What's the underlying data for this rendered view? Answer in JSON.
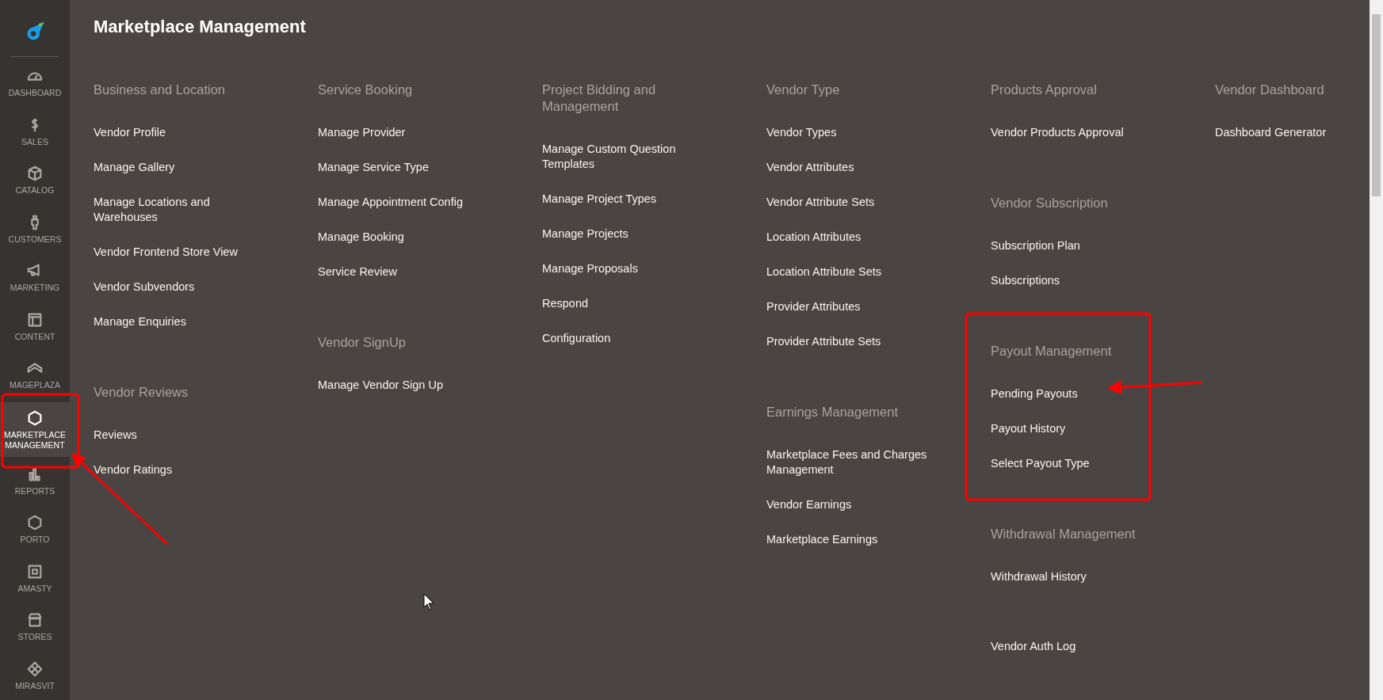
{
  "sidebar": {
    "items": [
      {
        "label": "DASHBOARD",
        "selected": false
      },
      {
        "label": "SALES",
        "selected": false
      },
      {
        "label": "CATALOG",
        "selected": false
      },
      {
        "label": "CUSTOMERS",
        "selected": false
      },
      {
        "label": "MARKETING",
        "selected": false
      },
      {
        "label": "CONTENT",
        "selected": false
      },
      {
        "label": "MAGEPLAZA",
        "selected": false
      },
      {
        "label": "MARKETPLACE MANAGEMENT",
        "selected": true
      },
      {
        "label": "REPORTS",
        "selected": false
      },
      {
        "label": "PORTO",
        "selected": false
      },
      {
        "label": "AMASTY",
        "selected": false
      },
      {
        "label": "STORES",
        "selected": false
      },
      {
        "label": "MIRASVIT",
        "selected": false
      }
    ]
  },
  "page_title": "Marketplace Management",
  "columns": [
    {
      "groups": [
        {
          "title": "Business and Location",
          "items": [
            "Vendor Profile",
            "Manage Gallery",
            "Manage Locations and Warehouses",
            "Vendor Frontend Store View",
            "Vendor Subvendors",
            "Manage Enquiries"
          ]
        },
        {
          "title": "Vendor Reviews",
          "items": [
            "Reviews",
            "Vendor Ratings"
          ]
        }
      ]
    },
    {
      "groups": [
        {
          "title": "Service Booking",
          "items": [
            "Manage Provider",
            "Manage Service Type",
            "Manage Appointment Config",
            "Manage Booking",
            "Service Review"
          ]
        },
        {
          "title": "Vendor SignUp",
          "items": [
            "Manage Vendor Sign Up"
          ]
        }
      ]
    },
    {
      "groups": [
        {
          "title": "Project Bidding and Management",
          "items": [
            "Manage Custom Question Templates",
            "Manage Project Types",
            "Manage Projects",
            "Manage Proposals",
            "Respond",
            "Configuration"
          ]
        }
      ]
    },
    {
      "groups": [
        {
          "title": "Vendor Type",
          "items": [
            "Vendor Types",
            "Vendor Attributes",
            "Vendor Attribute Sets",
            "Location Attributes",
            "Location Attribute Sets",
            "Provider Attributes",
            "Provider Attribute Sets"
          ]
        },
        {
          "title": "Earnings Management",
          "items": [
            "Marketplace Fees and Charges Management",
            "Vendor Earnings",
            "Marketplace Earnings"
          ]
        }
      ]
    },
    {
      "groups": [
        {
          "title": "Products Approval",
          "items": [
            "Vendor Products Approval"
          ]
        },
        {
          "title": "Vendor Subscription",
          "items": [
            "Subscription Plan",
            "Subscriptions"
          ]
        },
        {
          "title": "Payout Management",
          "items": [
            "Pending Payouts",
            "Payout History",
            "Select Payout Type"
          ]
        },
        {
          "title": "Withdrawal Management",
          "items": [
            "Withdrawal History"
          ]
        },
        {
          "items": [
            "Vendor Auth Log"
          ]
        }
      ]
    },
    {
      "groups": [
        {
          "title": "Vendor Dashboard",
          "items": [
            "Dashboard Generator"
          ]
        }
      ]
    }
  ]
}
